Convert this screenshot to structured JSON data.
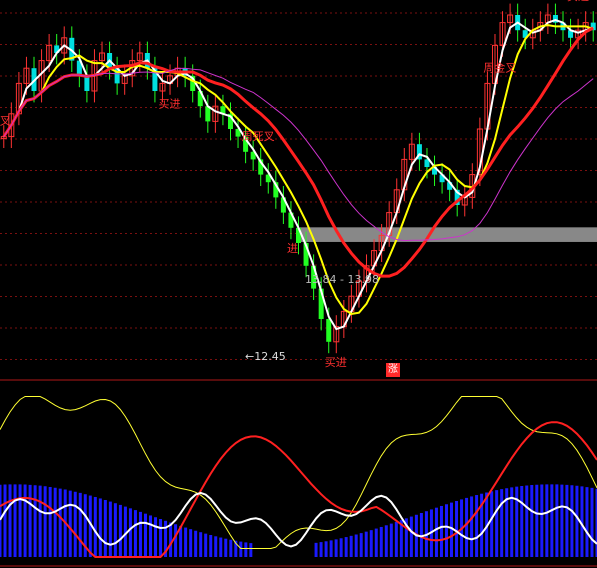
{
  "chart_data": [
    {
      "type": "candlestick",
      "title": "",
      "annotations": {
        "range_readout": "13.84 - 13.98",
        "low_marker": "←12.45",
        "signals": [
          {
            "text": "买进",
            "color": "#ff3030",
            "bar": 21
          },
          {
            "text": "周死叉",
            "color": "#ff3030",
            "bar": 32
          },
          {
            "text": "进",
            "color": "#ff3030",
            "bar": 38
          },
          {
            "text": "周金叉",
            "color": "#ff3030",
            "bar": 64
          },
          {
            "text": "买进",
            "color": "#ff3030",
            "bar": 43
          },
          {
            "text": "叉",
            "color": "#ff3030",
            "bar": 0
          },
          {
            "text": "买进",
            "color": "#ff3030",
            "bar": 94
          }
        ]
      },
      "price_range": [
        12.3,
        16.8
      ],
      "highlight_band": [
        13.84,
        13.98
      ],
      "series": [
        {
          "name": "",
          "color": "#ffffff"
        },
        {
          "name": "",
          "color": "#ffff00"
        },
        {
          "name": "",
          "color": "#ff2020"
        },
        {
          "name": "",
          "color": "#cc33cc"
        }
      ],
      "candles_close": [
        15.2,
        15.5,
        15.9,
        16.1,
        15.8,
        16.2,
        16.4,
        16.3,
        16.5,
        16.2,
        16.0,
        15.8,
        16.2,
        16.3,
        16.1,
        15.9,
        16.0,
        16.2,
        16.3,
        16.1,
        15.8,
        15.9,
        16.0,
        16.1,
        16.0,
        15.8,
        15.6,
        15.4,
        15.6,
        15.5,
        15.3,
        15.2,
        15.0,
        14.9,
        14.7,
        14.6,
        14.4,
        14.2,
        14.0,
        13.8,
        13.5,
        13.2,
        12.8,
        12.5,
        12.7,
        12.9,
        13.1,
        13.3,
        13.5,
        13.7,
        13.9,
        14.2,
        14.5,
        14.9,
        15.1,
        14.9,
        14.8,
        14.7,
        14.6,
        14.5,
        14.3,
        14.4,
        14.7,
        15.3,
        15.9,
        16.4,
        16.7,
        16.8,
        16.6,
        16.5,
        16.6,
        16.7,
        16.8,
        16.7,
        16.6,
        16.5,
        16.6,
        16.7,
        16.6
      ]
    },
    {
      "type": "line",
      "title": "",
      "ylim": [
        0,
        100
      ],
      "badge": "涨"
    }
  ]
}
